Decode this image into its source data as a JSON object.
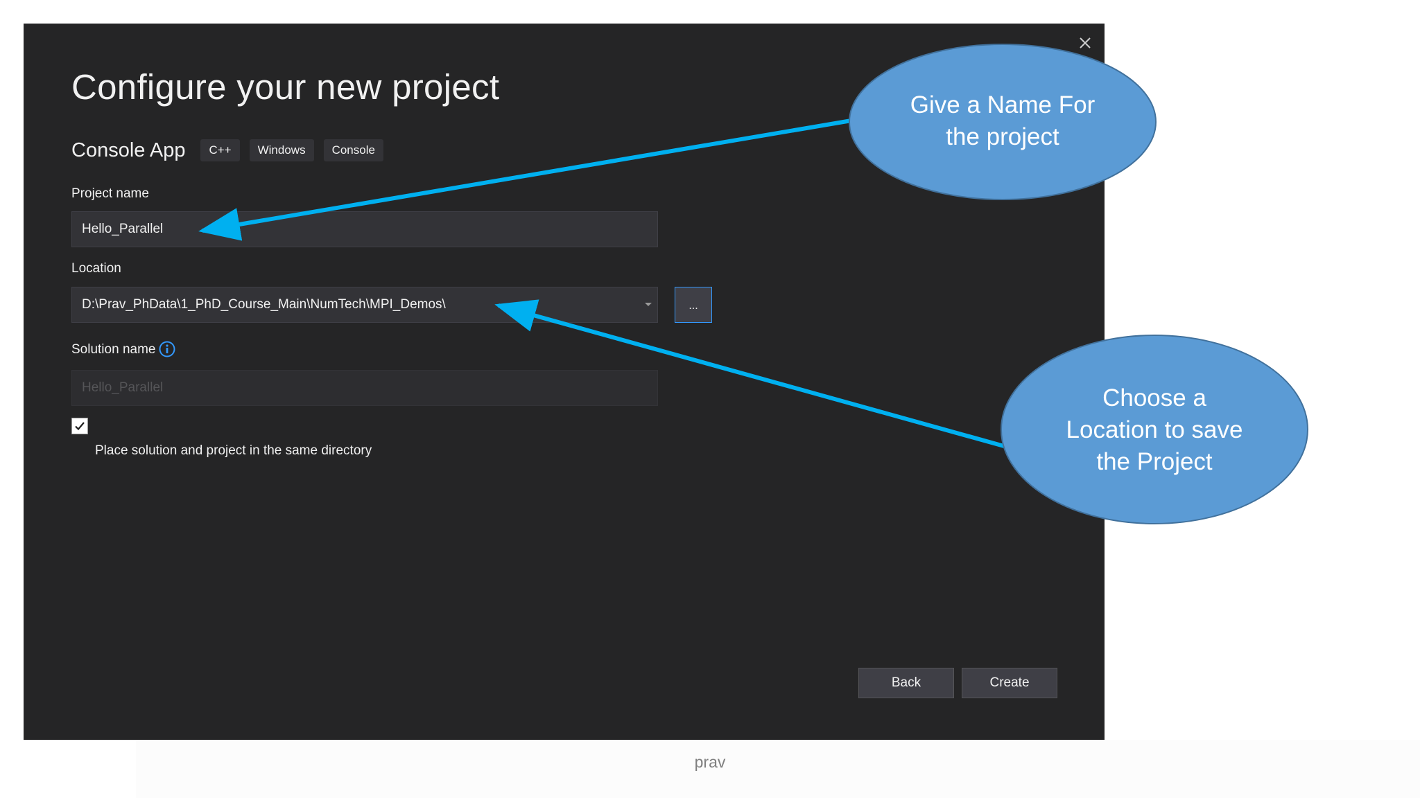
{
  "dialog": {
    "title": "Configure your new project",
    "template_name": "Console App",
    "tags": [
      "C++",
      "Windows",
      "Console"
    ],
    "project_name": {
      "label": "Project name",
      "value": "Hello_Parallel"
    },
    "location": {
      "label": "Location",
      "value": "D:\\Prav_PhData\\1_PhD_Course_Main\\NumTech\\MPI_Demos\\",
      "browse_label": "..."
    },
    "solution_name": {
      "label": "Solution name",
      "placeholder": "Hello_Parallel"
    },
    "same_directory": {
      "label": "Place solution and project in the same directory",
      "checked": true
    },
    "buttons": {
      "back": "Back",
      "create": "Create"
    }
  },
  "annotations": {
    "name_callout": [
      "Give a Name For",
      "the project"
    ],
    "location_callout": [
      "Choose a",
      "Location to save",
      "the Project"
    ]
  },
  "footer": {
    "text": "prav"
  },
  "colors": {
    "dialog_bg": "#252526",
    "field_bg": "#333337",
    "accent_blue": "#3399ff",
    "callout_fill": "#5b9bd5",
    "arrow": "#00b0f0"
  }
}
